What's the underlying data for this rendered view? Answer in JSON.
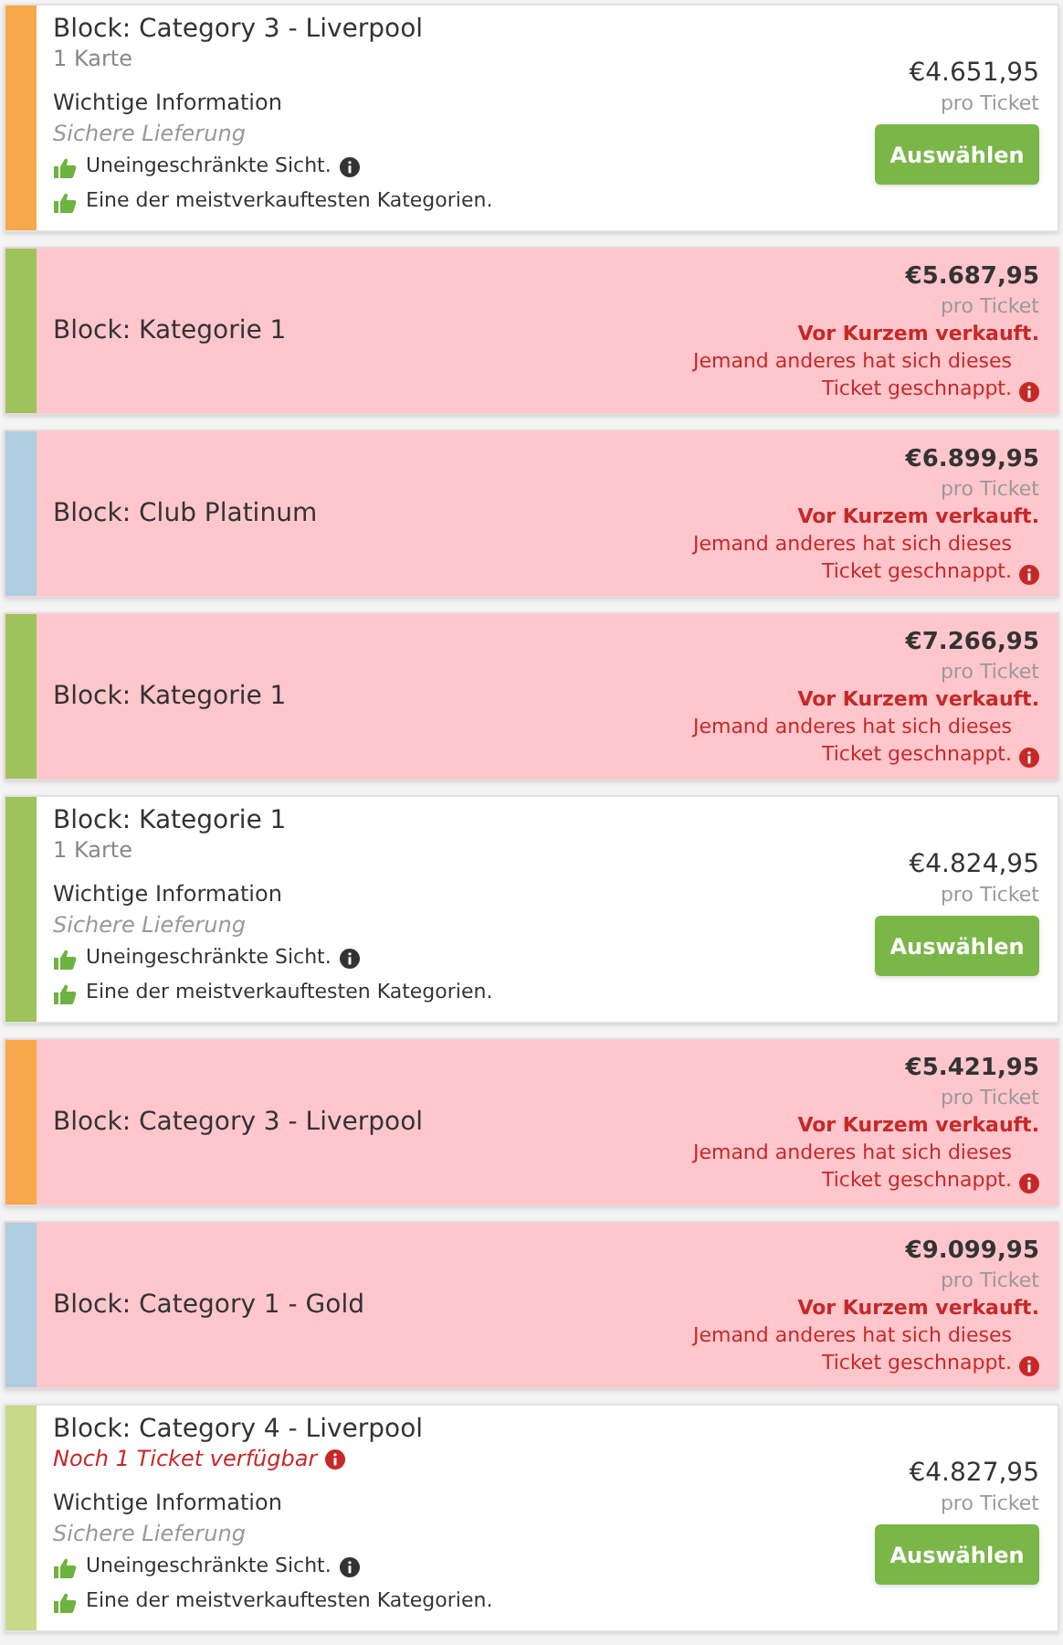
{
  "listings": [
    {
      "kind": "available",
      "color": "#f7a84a",
      "title": "Block: Category 3 - Liverpool",
      "quantity": "1 Karte",
      "info_heading": "Wichtige Information",
      "delivery": "Sichere Lieferung",
      "features": [
        {
          "text": "Uneingeschränkte Sicht.",
          "info": true
        },
        {
          "text": "Eine der meistverkauftesten Kategorien.",
          "info": false
        }
      ],
      "price": "€4.651,95",
      "per": "pro Ticket",
      "button": "Auswählen"
    },
    {
      "kind": "sold",
      "color": "#9dc35a",
      "title": "Block: Kategorie 1",
      "price": "€5.687,95",
      "per": "pro Ticket",
      "sold_title": "Vor Kurzem verkauft.",
      "sold_text": "Jemand anderes hat sich dieses Ticket geschnappt."
    },
    {
      "kind": "sold",
      "color": "#aecde0",
      "title": "Block: Club Platinum",
      "price": "€6.899,95",
      "per": "pro Ticket",
      "sold_title": "Vor Kurzem verkauft.",
      "sold_text": "Jemand anderes hat sich dieses Ticket geschnappt."
    },
    {
      "kind": "sold",
      "color": "#9dc35a",
      "title": "Block: Kategorie 1",
      "price": "€7.266,95",
      "per": "pro Ticket",
      "sold_title": "Vor Kurzem verkauft.",
      "sold_text": "Jemand anderes hat sich dieses Ticket geschnappt."
    },
    {
      "kind": "available",
      "color": "#9dc35a",
      "title": "Block: Kategorie 1",
      "quantity": "1 Karte",
      "info_heading": "Wichtige Information",
      "delivery": "Sichere Lieferung",
      "features": [
        {
          "text": "Uneingeschränkte Sicht.",
          "info": true
        },
        {
          "text": "Eine der meistverkauftesten Kategorien.",
          "info": false
        }
      ],
      "price": "€4.824,95",
      "per": "pro Ticket",
      "button": "Auswählen"
    },
    {
      "kind": "sold",
      "color": "#f7a84a",
      "title": "Block: Category 3 - Liverpool",
      "price": "€5.421,95",
      "per": "pro Ticket",
      "sold_title": "Vor Kurzem verkauft.",
      "sold_text": "Jemand anderes hat sich dieses Ticket geschnappt."
    },
    {
      "kind": "sold",
      "color": "#aecde0",
      "title": "Block: Category 1 - Gold",
      "price": "€9.099,95",
      "per": "pro Ticket",
      "sold_title": "Vor Kurzem verkauft.",
      "sold_text": "Jemand anderes hat sich dieses Ticket geschnappt."
    },
    {
      "kind": "available",
      "color": "#c9d98a",
      "title": "Block: Category 4 - Liverpool",
      "availability": "Noch 1 Ticket verfügbar",
      "info_heading": "Wichtige Information",
      "delivery": "Sichere Lieferung",
      "features": [
        {
          "text": "Uneingeschränkte Sicht.",
          "info": true
        },
        {
          "text": "Eine der meistverkauftesten Kategorien.",
          "info": false
        }
      ],
      "price": "€4.827,95",
      "per": "pro Ticket",
      "button": "Auswählen"
    }
  ]
}
